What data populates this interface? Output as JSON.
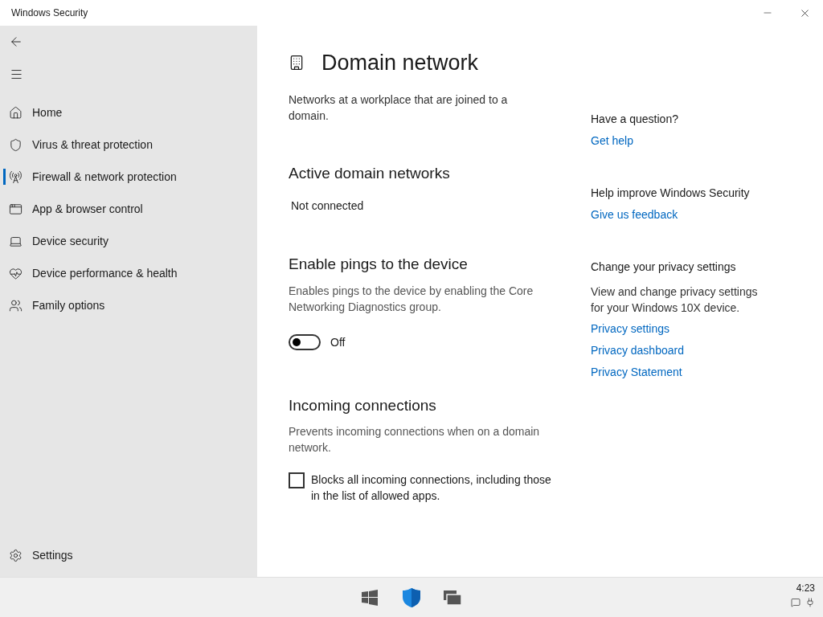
{
  "window": {
    "title": "Windows Security"
  },
  "sidebar": {
    "items": [
      {
        "label": "Home",
        "selected": false
      },
      {
        "label": "Virus & threat protection",
        "selected": false
      },
      {
        "label": "Firewall & network protection",
        "selected": true
      },
      {
        "label": "App & browser control",
        "selected": false
      },
      {
        "label": "Device security",
        "selected": false
      },
      {
        "label": "Device performance & health",
        "selected": false
      },
      {
        "label": "Family options",
        "selected": false
      }
    ],
    "settings": "Settings"
  },
  "page": {
    "title": "Domain network",
    "description": "Networks at a workplace that are joined to a domain.",
    "sections": [
      {
        "kind": "status",
        "title": "Active domain networks",
        "value": "Not connected"
      },
      {
        "kind": "toggle",
        "title": "Enable pings to the device",
        "description": "Enables pings to the device by enabling the Core Networking Diagnostics group.",
        "on": false,
        "state_label": "Off"
      },
      {
        "kind": "checkbox",
        "title": "Incoming connections",
        "description": "Prevents incoming connections when on a domain network.",
        "checked": false,
        "label": "Blocks all incoming connections, including those in the list of allowed apps."
      }
    ]
  },
  "aside": [
    {
      "title": "Have a question?",
      "links": [
        "Get help"
      ]
    },
    {
      "title": "Help improve Windows Security",
      "links": [
        "Give us feedback"
      ]
    },
    {
      "title": "Change your privacy settings",
      "description": "View and change privacy settings for your Windows 10X device.",
      "links": [
        "Privacy settings",
        "Privacy dashboard",
        "Privacy Statement"
      ]
    }
  ],
  "taskbar": {
    "time": "4:23"
  }
}
